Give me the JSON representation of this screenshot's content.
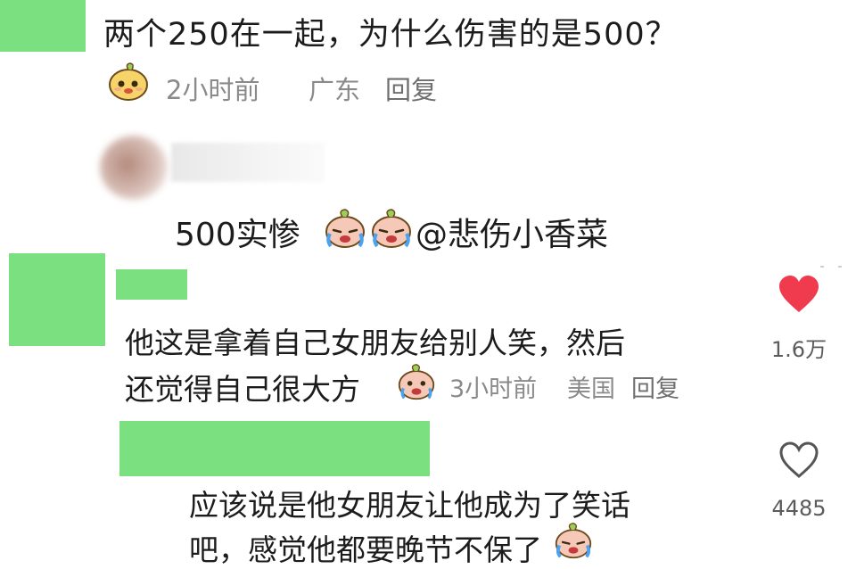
{
  "post": {
    "question": "两个250在一起，为什么伤害的是500？",
    "time": "2小时前",
    "location": "广东",
    "reply": "回复"
  },
  "reply_line": {
    "text_main": "500实惨",
    "mention": "@悲伤小香菜"
  },
  "comment1": {
    "line1": "他这是拿着自己女朋友给别人笑，然后",
    "line2": "还觉得自己很大方",
    "time": "3小时前",
    "location": "美国",
    "reply": "回复",
    "likes": "1.6万"
  },
  "comment2": {
    "line1": "应该说是他女朋友让他成为了笑话",
    "line2": "吧，感觉他都要晚节不保了",
    "likes": "4485"
  },
  "colors": {
    "redaction_green": "#7be07f",
    "heart_red": "#f03a4e",
    "meta_gray": "#8a8a8a",
    "text_dark": "#1c1c1c"
  },
  "icons": [
    "sticker-emoji-icon",
    "crying-sticker-icon",
    "heart-filled-icon",
    "heart-outline-icon"
  ]
}
